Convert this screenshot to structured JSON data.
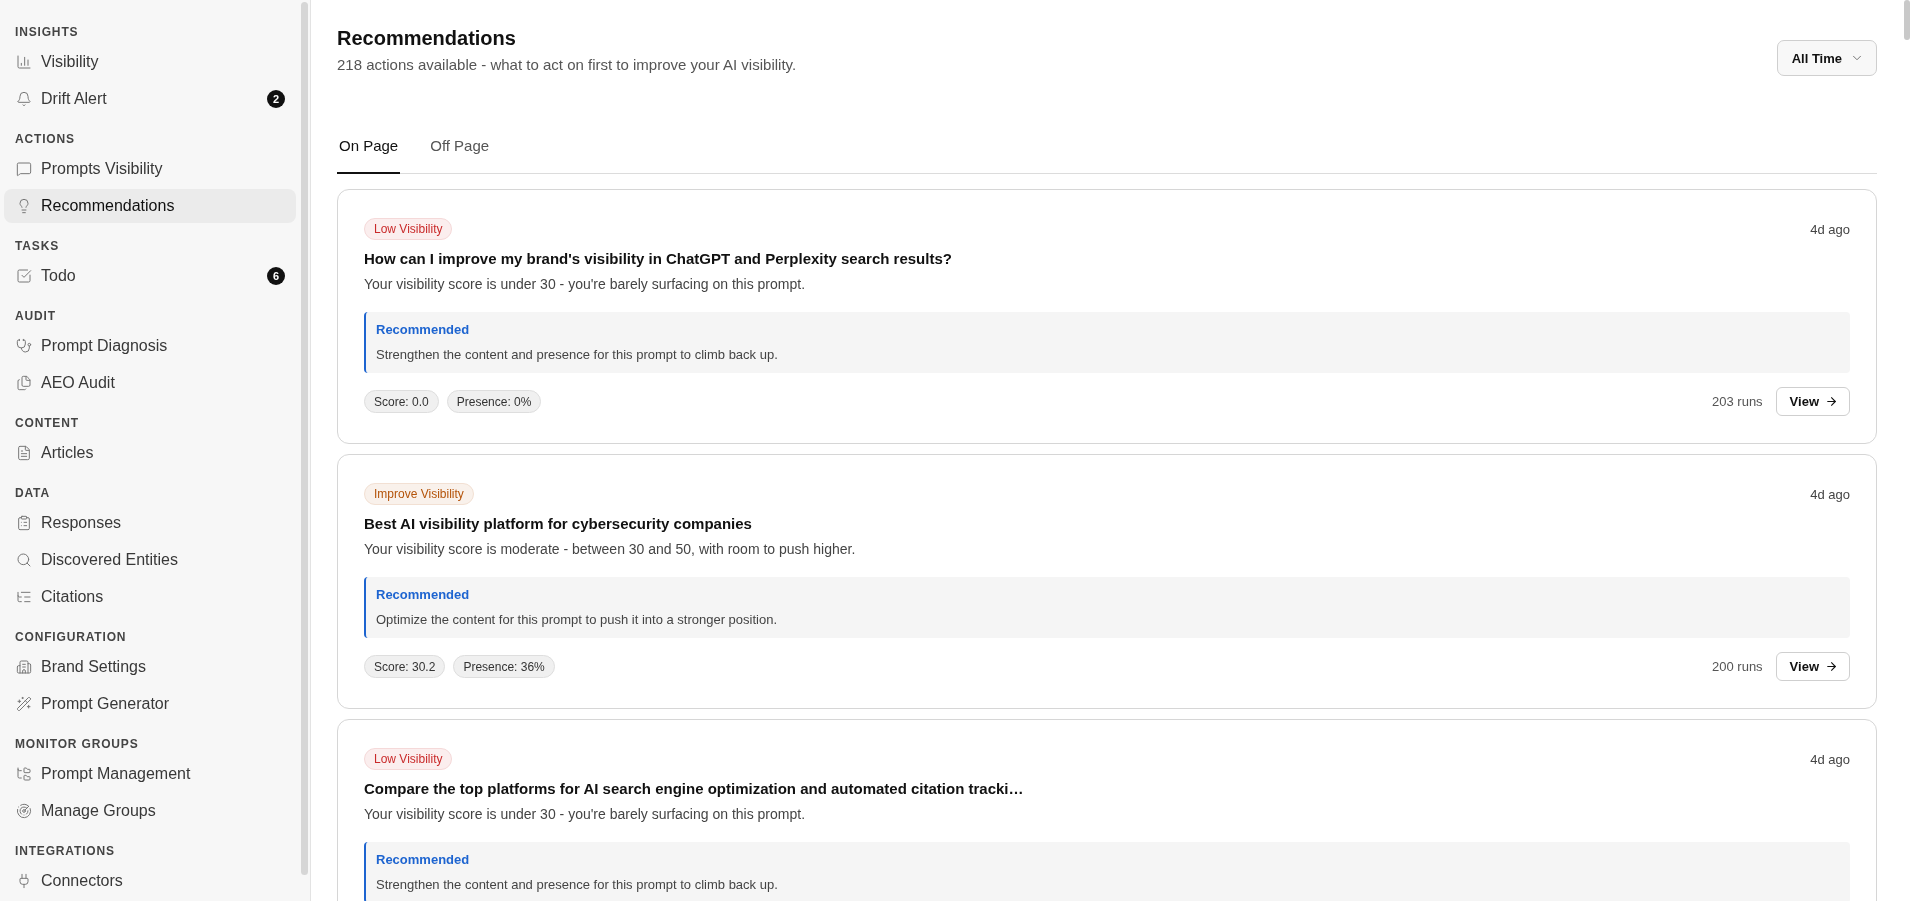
{
  "sidebar": {
    "sections": [
      {
        "title": "INSIGHTS",
        "items": [
          {
            "label": "Visibility",
            "selected": false
          },
          {
            "label": "Drift Alert",
            "badge": "2",
            "selected": false
          }
        ]
      },
      {
        "title": "ACTIONS",
        "items": [
          {
            "label": "Prompts Visibility",
            "selected": false
          },
          {
            "label": "Recommendations",
            "selected": true
          }
        ]
      },
      {
        "title": "TASKS",
        "items": [
          {
            "label": "Todo",
            "badge": "6",
            "selected": false
          }
        ]
      },
      {
        "title": "AUDIT",
        "items": [
          {
            "label": "Prompt Diagnosis",
            "selected": false
          },
          {
            "label": "AEO Audit",
            "selected": false
          }
        ]
      },
      {
        "title": "CONTENT",
        "items": [
          {
            "label": "Articles",
            "selected": false
          }
        ]
      },
      {
        "title": "DATA",
        "items": [
          {
            "label": "Responses",
            "selected": false
          },
          {
            "label": "Discovered Entities",
            "selected": false
          },
          {
            "label": "Citations",
            "selected": false
          }
        ]
      },
      {
        "title": "CONFIGURATION",
        "items": [
          {
            "label": "Brand Settings",
            "selected": false
          },
          {
            "label": "Prompt Generator",
            "selected": false
          }
        ]
      },
      {
        "title": "MONITOR GROUPS",
        "items": [
          {
            "label": "Prompt Management",
            "selected": false
          },
          {
            "label": "Manage Groups",
            "selected": false
          }
        ]
      },
      {
        "title": "INTEGRATIONS",
        "items": [
          {
            "label": "Connectors",
            "selected": false
          }
        ]
      }
    ]
  },
  "header": {
    "title": "Recommendations",
    "subtitle": "218 actions available - what to act on first to improve your AI visibility.",
    "range_button": "All Time"
  },
  "tabs": [
    {
      "label": "On Page",
      "selected": true
    },
    {
      "label": "Off Page",
      "selected": false
    }
  ],
  "cards": [
    {
      "badge": {
        "label": "Low Visibility",
        "color": "#c92a2a"
      },
      "time": "4d ago",
      "title": "How can I improve my brand's visibility in ChatGPT and Perplexity search results?",
      "description": "Your visibility score is under 30 - you're barely surfacing on this prompt.",
      "recommendation": {
        "heading": "Recommended",
        "text": "Strengthen the content and presence for this prompt to climb back up."
      },
      "stats": [
        "Score: 0.0",
        "Presence: 0%"
      ],
      "runs": "203 runs",
      "action": "View"
    },
    {
      "badge": {
        "label": "Improve Visibility",
        "color": "#b45309"
      },
      "time": "4d ago",
      "title": "Best AI visibility platform for cybersecurity companies",
      "description": "Your visibility score is moderate - between 30 and 50, with room to push higher.",
      "recommendation": {
        "heading": "Recommended",
        "text": "Optimize the content for this prompt to push it into a stronger position."
      },
      "stats": [
        "Score: 30.2",
        "Presence: 36%"
      ],
      "runs": "200 runs",
      "action": "View"
    },
    {
      "badge": {
        "label": "Low Visibility",
        "color": "#c92a2a"
      },
      "time": "4d ago",
      "title": "Compare the top platforms for AI search engine optimization and automated citation tracki…",
      "description": "Your visibility score is under 30 - you're barely surfacing on this prompt.",
      "recommendation": {
        "heading": "Recommended",
        "text": "Strengthen the content and presence for this prompt to climb back up."
      }
    }
  ]
}
